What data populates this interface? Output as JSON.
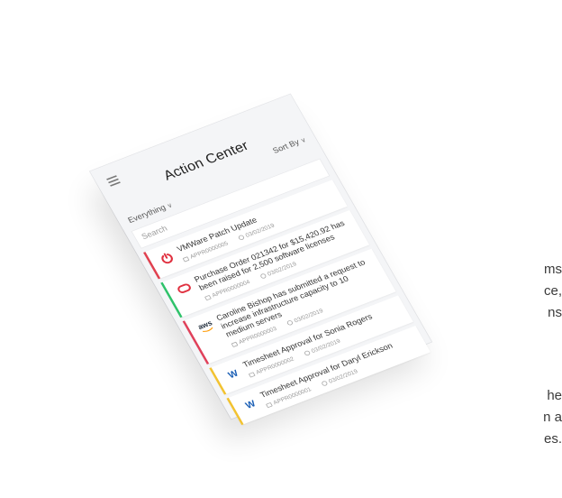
{
  "background_text": {
    "lines": [
      "ms",
      "ce,",
      "ns",
      "he",
      "n a",
      "es."
    ]
  },
  "app": {
    "title": "Action Center",
    "sort_label": "Sort By",
    "filter_label": "Everything",
    "search_placeholder": "Search"
  },
  "items": [
    {
      "title": "VMWare Patch Update",
      "id": "APPR0000005",
      "date": "03/02/2019",
      "logo": "power-icon",
      "color": "#e0404f"
    },
    {
      "title": "Purchase Order 021342 for $15,420.92 has been raised for 2,500 software licenses",
      "id": "APPR0000004",
      "date": "03/02/2019",
      "logo": "oracle-icon",
      "color": "#2ec26a"
    },
    {
      "title": "Caroline Bishop has submitted a request to increase infrastructure capacity to 10 medium servers",
      "id": "APPR0000003",
      "date": "03/02/2019",
      "logo": "aws-icon",
      "color": "#e0405a",
      "logo_text": "aws"
    },
    {
      "title": "Timesheet Approval for Sonia Rogers",
      "id": "APPR0000002",
      "date": "03/02/2019",
      "logo": "w-icon",
      "color": "#f2c230",
      "logo_text": "W"
    },
    {
      "title": "Timesheet Approval for Daryl Erickson",
      "id": "APPR0000001",
      "date": "03/02/2019",
      "logo": "w-icon",
      "color": "#f2c230",
      "logo_text": "W"
    }
  ]
}
